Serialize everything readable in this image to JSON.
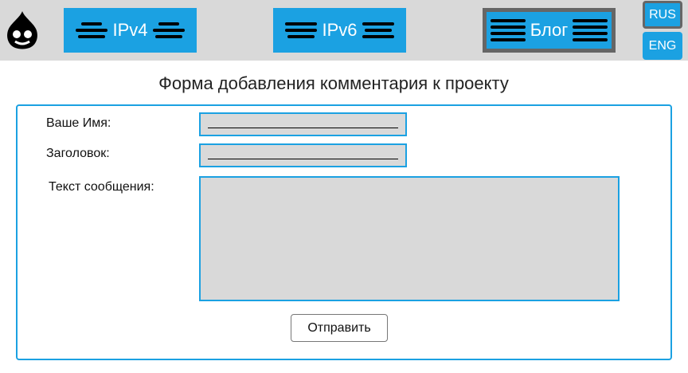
{
  "nav": {
    "items": [
      {
        "label": "IPv4",
        "active": false
      },
      {
        "label": "IPv6",
        "active": false
      },
      {
        "label": "Блог",
        "active": true
      }
    ]
  },
  "lang": {
    "items": [
      {
        "label": "RUS",
        "selected": true
      },
      {
        "label": "ENG",
        "selected": false
      }
    ]
  },
  "page": {
    "title": "Форма добавления комментария к проекту"
  },
  "form": {
    "name_label": "Ваше Имя:",
    "name_value": "",
    "title_label": "Заголовок:",
    "title_value": "",
    "message_label": "Текст сообщения:",
    "message_value": "",
    "submit_label": "Отправить"
  },
  "colors": {
    "accent": "#1ba1e2",
    "topbar": "#d9d9d9",
    "input_bg": "#d9d9d9",
    "active_border": "#666666"
  },
  "icons": {
    "logo": "drupal-drop-icon",
    "menu": "bars-icon"
  }
}
